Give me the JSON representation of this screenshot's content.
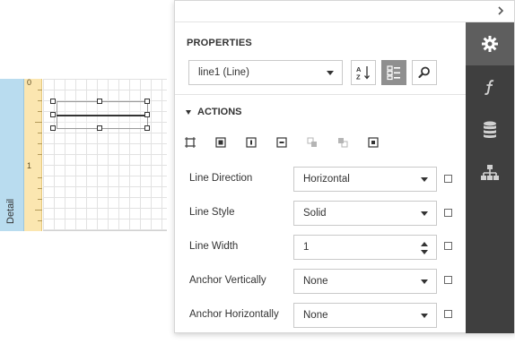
{
  "designer": {
    "band_label": "Detail",
    "ruler_marks": [
      "0",
      "1"
    ]
  },
  "panel": {
    "collapse_icon": "chevron-right-icon",
    "heading": "PROPERTIES",
    "component_selector": {
      "value": "line1 (Line)"
    },
    "toolbar": [
      {
        "name": "sort-alphabetical-button",
        "icon": "sort-az-icon",
        "active": false
      },
      {
        "name": "categorized-view-button",
        "icon": "categorized-list-icon",
        "active": true
      },
      {
        "name": "search-button",
        "icon": "search-icon",
        "active": false
      }
    ],
    "actions_section": {
      "title": "ACTIONS",
      "expanded": true,
      "icons": [
        "fit-bounds-to-container-icon",
        "fit-bounds-to-text-icon",
        "center-horizontally-icon",
        "center-vertically-icon",
        "bring-to-front-icon",
        "send-to-back-icon",
        "align-to-grid-icon"
      ]
    },
    "properties": [
      {
        "label": "Line Direction",
        "value": "Horizontal",
        "editor": "dropdown"
      },
      {
        "label": "Line Style",
        "value": "Solid",
        "editor": "dropdown"
      },
      {
        "label": "Line Width",
        "value": "1",
        "editor": "spinner"
      },
      {
        "label": "Anchor Vertically",
        "value": "None",
        "editor": "dropdown"
      },
      {
        "label": "Anchor Horizontally",
        "value": "None",
        "editor": "dropdown"
      }
    ]
  },
  "sidebar": {
    "tabs": [
      {
        "name": "properties-tab",
        "icon": "gear-icon",
        "active": true
      },
      {
        "name": "expressions-tab",
        "icon": "function-icon",
        "active": false
      },
      {
        "name": "field-list-tab",
        "icon": "database-icon",
        "active": false
      },
      {
        "name": "report-explorer-tab",
        "icon": "hierarchy-icon",
        "active": false
      }
    ]
  },
  "colors": {
    "sidebar_bg": "#3f3f3f",
    "sidebar_active": "#5e5e5e",
    "band_tab": "#b9dcef",
    "ruler": "#fbe6b0",
    "active_toggle": "#8f8f8f"
  }
}
